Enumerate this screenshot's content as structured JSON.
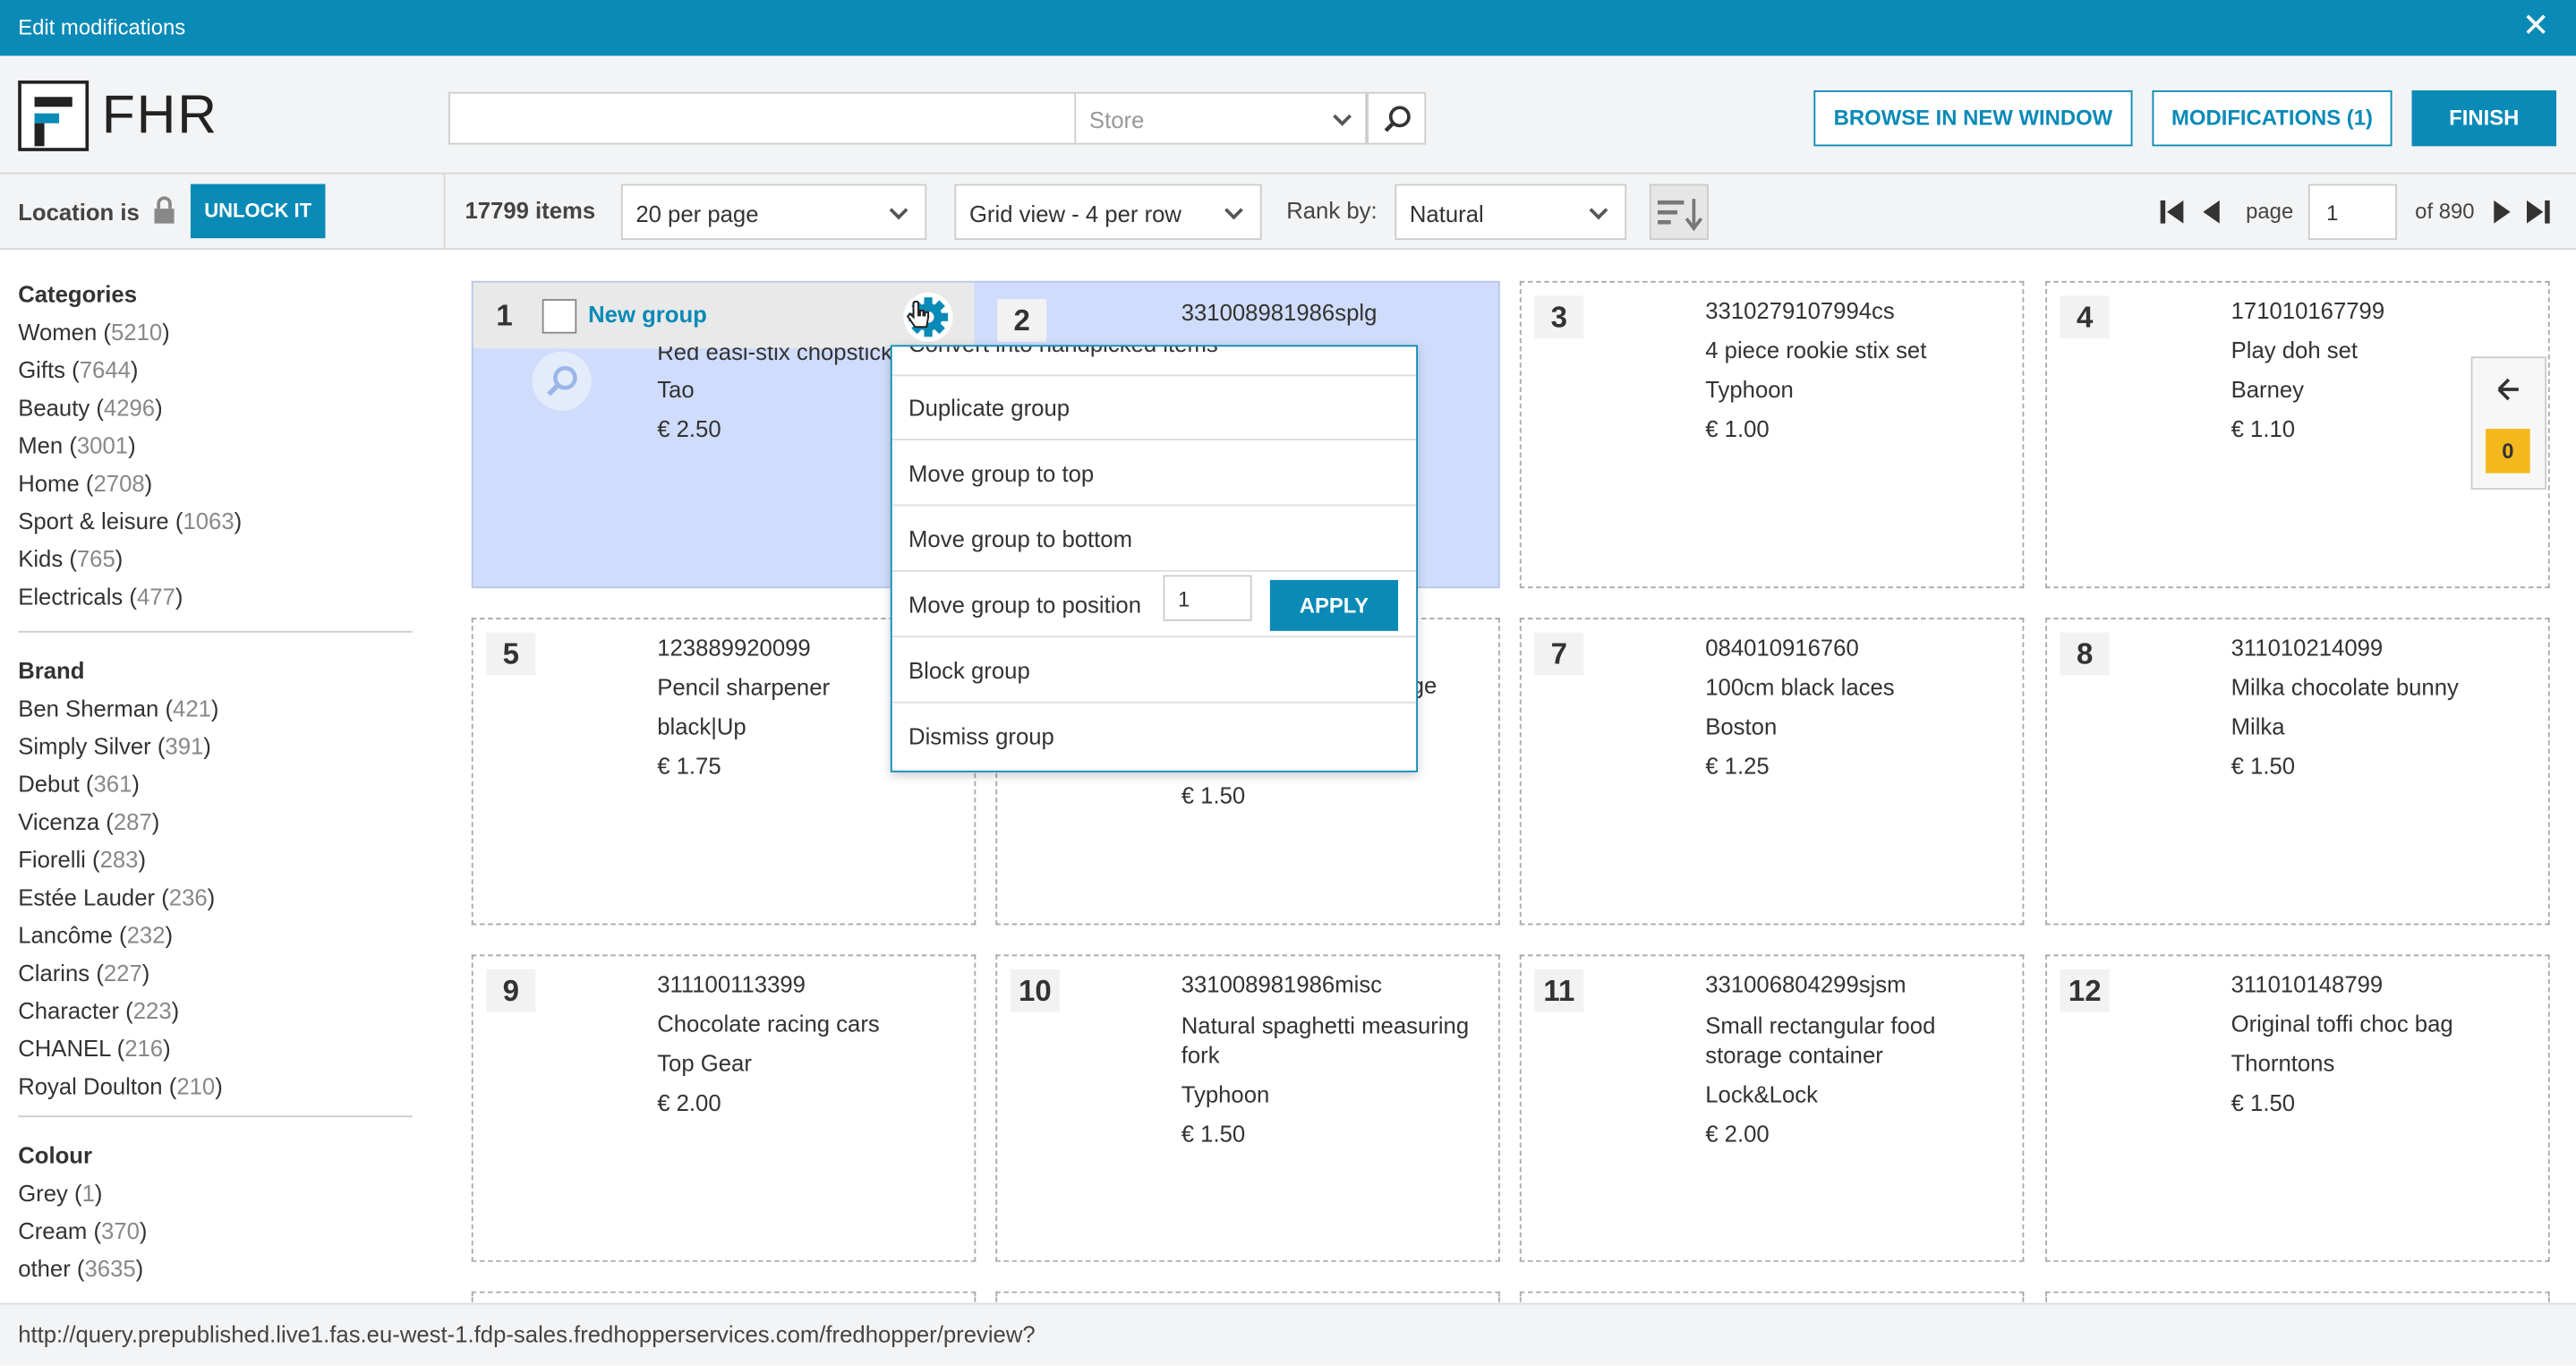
{
  "window": {
    "title": "Edit modifications",
    "close_glyph": "✕"
  },
  "header": {
    "logo_text": "FHR",
    "search": {
      "value": "",
      "placeholder": ""
    },
    "store_select": {
      "value": "Store"
    },
    "buttons": {
      "browse": "BROWSE IN NEW WINDOW",
      "modifications": "MODIFICATIONS (1)",
      "finish": "FINISH"
    }
  },
  "toolbar": {
    "location_label": "Location is",
    "unlock_label": "UNLOCK IT",
    "items_count": "17799 items",
    "per_page": "20 per page",
    "view": "Grid view - 4 per row",
    "rank_label": "Rank by:",
    "rank_value": "Natural",
    "page_label": "page",
    "page_value": "1",
    "page_total": "of 890"
  },
  "sidebar": {
    "categories": {
      "title": "Categories",
      "items": [
        {
          "name": "Women",
          "count": "5210"
        },
        {
          "name": "Gifts",
          "count": "7644"
        },
        {
          "name": "Beauty",
          "count": "4296"
        },
        {
          "name": "Men",
          "count": "3001"
        },
        {
          "name": "Home",
          "count": "2708"
        },
        {
          "name": "Sport & leisure",
          "count": "1063"
        },
        {
          "name": "Kids",
          "count": "765"
        },
        {
          "name": "Electricals",
          "count": "477"
        }
      ]
    },
    "brand": {
      "title": "Brand",
      "items": [
        {
          "name": "Ben Sherman",
          "count": "421"
        },
        {
          "name": "Simply Silver",
          "count": "391"
        },
        {
          "name": "Debut",
          "count": "361"
        },
        {
          "name": "Vicenza",
          "count": "287"
        },
        {
          "name": "Fiorelli",
          "count": "283"
        },
        {
          "name": "Estée Lauder",
          "count": "236"
        },
        {
          "name": "Lancôme",
          "count": "232"
        },
        {
          "name": "Clarins",
          "count": "227"
        },
        {
          "name": "Character",
          "count": "223"
        },
        {
          "name": "CHANEL",
          "count": "216"
        },
        {
          "name": "Royal Doulton",
          "count": "210"
        }
      ]
    },
    "colour": {
      "title": "Colour",
      "items": [
        {
          "name": "Grey",
          "count": "1"
        },
        {
          "name": "Cream",
          "count": "370"
        },
        {
          "name": "other",
          "count": "3635"
        }
      ]
    }
  },
  "group": {
    "number": "1",
    "title": "New group",
    "item": {
      "name": "Red easi-stix chopsticks",
      "brand": "Tao",
      "price": "€ 2.50"
    },
    "item2": {
      "id": "331008981986splg"
    }
  },
  "menu": {
    "partial_top": "Convert into handpicked items",
    "items": [
      "Duplicate group",
      "Move group to top",
      "Move group to bottom",
      "Move group to position",
      "Block group",
      "Dismiss group"
    ],
    "position_value": "1",
    "apply_label": "APPLY"
  },
  "products": [
    {
      "n": "2",
      "id": "331008981986splg"
    },
    {
      "n": "3",
      "id": "3310279107994cs",
      "name": "4 piece rookie stix set",
      "brand": "Typhoon",
      "price": "€ 1.00"
    },
    {
      "n": "4",
      "id": "171010167799",
      "name": "Play doh set",
      "brand": "Barney",
      "price": "€ 1.10"
    },
    {
      "n": "5",
      "id": "123889920099",
      "name": "Pencil sharpener",
      "brand": "black|Up",
      "price": "€ 1.75"
    },
    {
      "n": "6",
      "name_tail": "ge",
      "price": "€ 1.50"
    },
    {
      "n": "7",
      "id": "084010916760",
      "name": "100cm black laces",
      "brand": "Boston",
      "price": "€ 1.25"
    },
    {
      "n": "8",
      "id": "311010214099",
      "name": "Milka chocolate bunny",
      "brand": "Milka",
      "price": "€ 1.50"
    },
    {
      "n": "9",
      "id": "311100113399",
      "name": "Chocolate racing cars",
      "brand": "Top Gear",
      "price": "€ 2.00"
    },
    {
      "n": "10",
      "id": "331008981986misc",
      "name": "Natural spaghetti measuring fork",
      "brand": "Typhoon",
      "price": "€ 1.50"
    },
    {
      "n": "11",
      "id": "331006804299sjsm",
      "name": "Small rectangular food storage container",
      "brand": "Lock&Lock",
      "price": "€ 2.00"
    },
    {
      "n": "12",
      "id": "311010148799",
      "name": "Original toffi choc bag",
      "brand": "Thorntons",
      "price": "€ 1.50"
    }
  ],
  "sidepanel": {
    "badge": "0"
  },
  "status_url": "http://query.prepublished.live1.fas.eu-west-1.fdp-sales.fredhopperservices.com/fredhopper/preview?",
  "colors": {
    "accent": "#0a8ab6",
    "group_bg": "#cfdcfb",
    "badge": "#f5b81c"
  }
}
